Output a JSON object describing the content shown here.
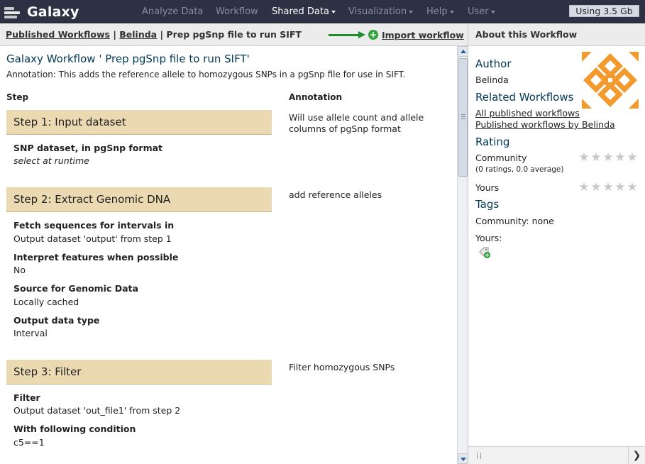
{
  "masthead": {
    "brand": "Galaxy",
    "nav": [
      {
        "label": "Analyze Data",
        "has_menu": false,
        "active": false
      },
      {
        "label": "Workflow",
        "has_menu": false,
        "active": false
      },
      {
        "label": "Shared Data",
        "has_menu": true,
        "active": true
      },
      {
        "label": "Visualization",
        "has_menu": true,
        "active": false
      },
      {
        "label": "Help",
        "has_menu": true,
        "active": false
      },
      {
        "label": "User",
        "has_menu": true,
        "active": false
      }
    ],
    "usage": "Using 3.5 Gb"
  },
  "breadcrumb": {
    "root": "Published Workflows",
    "sep": "|",
    "owner": "Belinda",
    "current": "Prep pgSnp file to run SIFT"
  },
  "import_label": "Import workflow",
  "workflow": {
    "title": "Galaxy Workflow ' Prep pgSnp file to run SIFT'",
    "annotation": "Annotation: This adds the reference allele to homozygous SNPs in a pgSnp file for use in SIFT.",
    "col_step": "Step",
    "col_annotation": "Annotation",
    "steps": [
      {
        "title": "Step 1: Input dataset",
        "annotation": "Will use allele count and allele columns of pgSnp format",
        "params": [
          {
            "label": "SNP dataset, in pgSnp format",
            "value": "select at runtime",
            "italic": true
          }
        ]
      },
      {
        "title": "Step 2: Extract Genomic DNA",
        "annotation": "add reference alleles",
        "params": [
          {
            "label": "Fetch sequences for intervals in",
            "value": "Output dataset 'output' from step 1"
          },
          {
            "label": "Interpret features when possible",
            "value": "No"
          },
          {
            "label": "Source for Genomic Data",
            "value": "Locally cached"
          },
          {
            "label": "Output data type",
            "value": "Interval"
          }
        ]
      },
      {
        "title": "Step 3: Filter",
        "annotation": "Filter homozygous SNPs",
        "params": [
          {
            "label": "Filter",
            "value": "Output dataset 'out_file1' from step 2"
          },
          {
            "label": "With following condition",
            "value": "c5==1"
          }
        ]
      }
    ]
  },
  "side": {
    "header": "About this Workflow",
    "author_heading": "Author",
    "author": "Belinda",
    "related_heading": "Related Workflows",
    "related_links": [
      "All published workflows",
      "Published workflows by Belinda"
    ],
    "rating_heading": "Rating",
    "community_label": "Community",
    "community_rating": "(0 ratings, 0.0 average)",
    "community_stars": 0,
    "yours_label": "Yours",
    "yours_stars": 0,
    "tags_heading": "Tags",
    "community_tags": "Community: none",
    "yours_tags": "Yours:"
  },
  "colors": {
    "masthead": "#2c3143",
    "step_header": "#ebd9b2",
    "heading": "#023858",
    "avatar": "#f29a2e",
    "import_icon": "#2fa33c"
  }
}
